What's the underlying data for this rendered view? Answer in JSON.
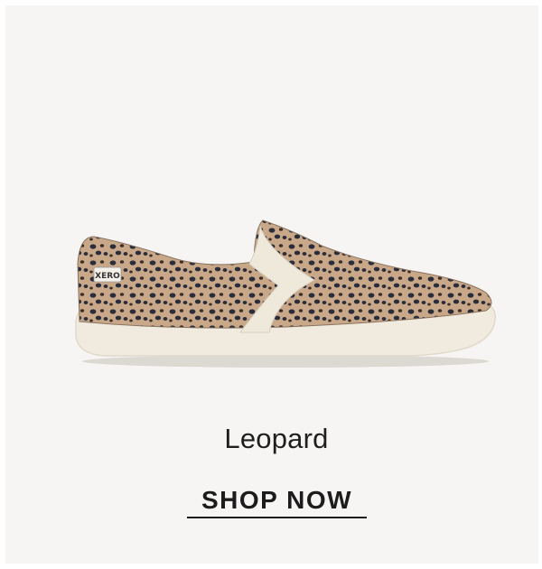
{
  "product": {
    "name": "Leopard",
    "image_icon": "leopard-slip-on-shoe-icon",
    "brand_tag": "XERO"
  },
  "cta": {
    "label": "SHOP NOW"
  },
  "colors": {
    "background": "#f6f5f4",
    "text": "#1c1c1c",
    "sole": "#f1ebdf",
    "upper_base": "#c9a88a",
    "spots": "#2a2d3a"
  }
}
